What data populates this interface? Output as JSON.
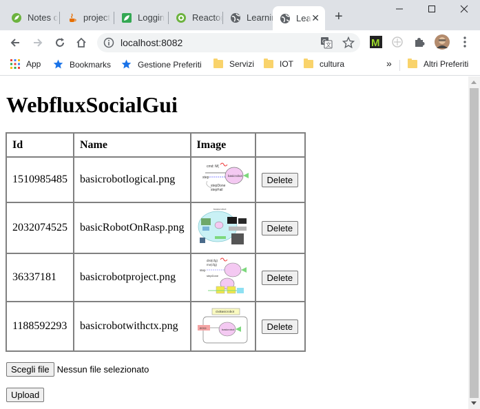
{
  "browser": {
    "tabs": [
      {
        "label": "Notes o",
        "icon": "spring-leaf-icon",
        "active": false
      },
      {
        "label": "project",
        "icon": "java-cup-icon",
        "active": false
      },
      {
        "label": "Loggin",
        "icon": "spring-green-icon",
        "active": false
      },
      {
        "label": "Reactor",
        "icon": "reactor-icon",
        "active": false
      },
      {
        "label": "Learnin",
        "icon": "globe-icon",
        "active": false
      },
      {
        "label": "Lea",
        "icon": "globe-icon",
        "active": true
      }
    ],
    "url": "localhost:8082",
    "bookmarks": [
      {
        "label": "App",
        "icon": "apps-grid-icon"
      },
      {
        "label": "Bookmarks",
        "icon": "star-icon"
      },
      {
        "label": "Gestione Preferiti",
        "icon": "star-icon"
      },
      {
        "label": "Servizi",
        "icon": "folder-icon"
      },
      {
        "label": "IOT",
        "icon": "folder-icon"
      },
      {
        "label": "cultura",
        "icon": "folder-icon"
      }
    ],
    "bookmarks_overflow": "»",
    "other_bookmarks": "Altri Preferiti",
    "colors": {
      "tabstrip": "#dee1e6",
      "star": "#1a73e8",
      "folder": "#f9d36b"
    }
  },
  "page": {
    "title": "WebfluxSocialGui",
    "table": {
      "headers": [
        "Id",
        "Name",
        "Image",
        ""
      ],
      "rows": [
        {
          "id": "1510985485",
          "name": "basicrobotlogical.png",
          "action": "Delete"
        },
        {
          "id": "2032074525",
          "name": "basicRobotOnRasp.png",
          "action": "Delete"
        },
        {
          "id": "36337181",
          "name": "basicrobotproject.png",
          "action": "Delete"
        },
        {
          "id": "1188592293",
          "name": "basicrobotwithctx.png",
          "action": "Delete"
        }
      ]
    },
    "file_input": {
      "button": "Scegli file",
      "status": "Nessun file selezionato"
    },
    "upload_label": "Upload"
  }
}
